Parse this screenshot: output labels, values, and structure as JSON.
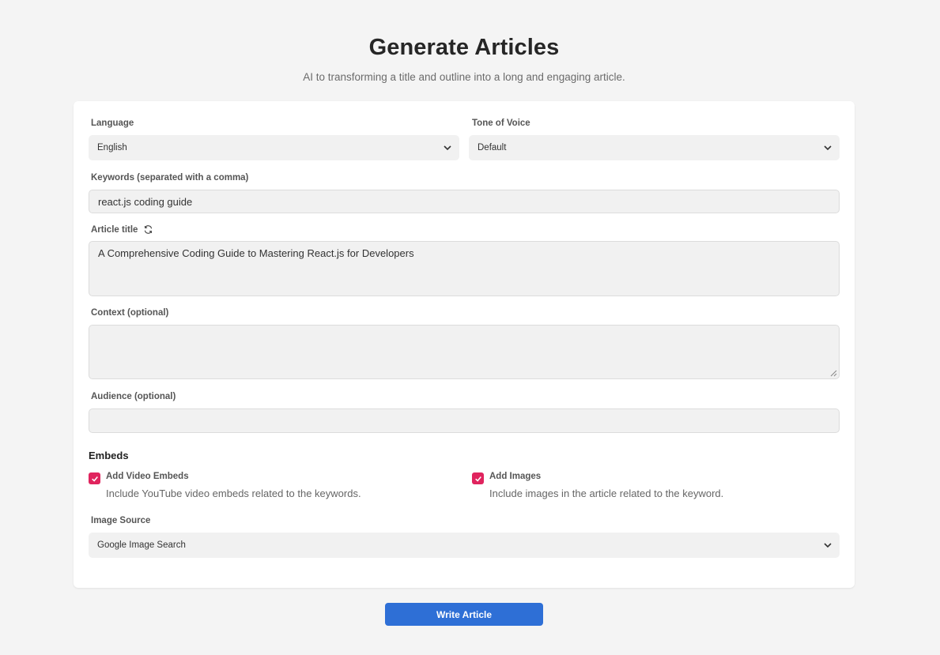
{
  "header": {
    "title": "Generate Articles",
    "subtitle": "AI to transforming a title and outline into a long and engaging article."
  },
  "form": {
    "language": {
      "label": "Language",
      "value": "English"
    },
    "tone": {
      "label": "Tone of Voice",
      "value": "Default"
    },
    "keywords": {
      "label": "Keywords (separated with a comma)",
      "value": "react.js coding guide"
    },
    "article_title": {
      "label": "Article title",
      "value": "A Comprehensive Coding Guide to Mastering React.js for Developers",
      "refresh_icon": "refresh-icon"
    },
    "context": {
      "label": "Context (optional)",
      "value": ""
    },
    "audience": {
      "label": "Audience (optional)",
      "value": ""
    },
    "embeds": {
      "title": "Embeds",
      "video": {
        "label": "Add Video Embeds",
        "description": "Include YouTube video embeds related to the keywords.",
        "checked": true
      },
      "images": {
        "label": "Add Images",
        "description": "Include images in the article related to the keyword.",
        "checked": true
      }
    },
    "image_source": {
      "label": "Image Source",
      "value": "Google Image Search"
    }
  },
  "actions": {
    "submit_label": "Write Article"
  },
  "colors": {
    "accent": "#2e6fd6",
    "checkbox": "#e0245e",
    "background": "#f4f4f4"
  }
}
